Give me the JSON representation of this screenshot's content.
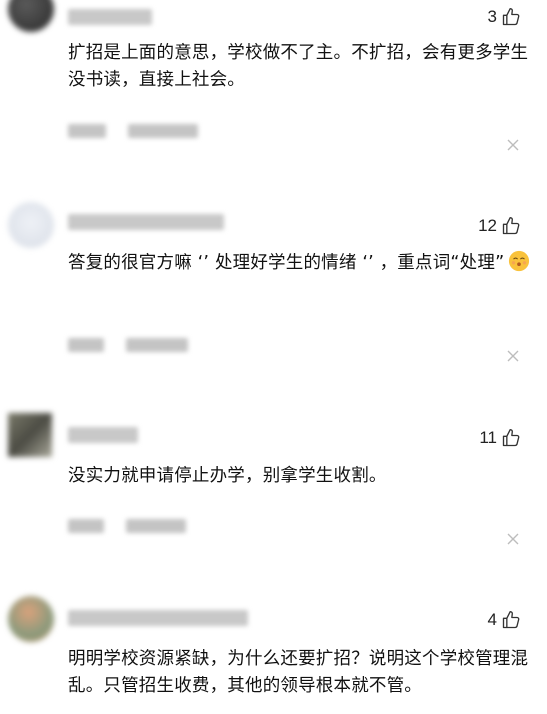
{
  "comments": [
    {
      "likes": "3",
      "text": "扩招是上面的意思，学校做不了主。不扩招，会有更多学生没书读，直接上社会。"
    },
    {
      "likes": "12",
      "text": "答复的很官方嘛 ‘’ 处理好学生的情绪 ‘’ ，重点词“处理”"
    },
    {
      "likes": "11",
      "text": "没实力就申请停止办学，别拿学生收割。"
    },
    {
      "likes": "4",
      "text": "明明学校资源紧缺，为什么还要扩招？说明这个学校管理混乱。只管招生收费，其他的领导根本就不管。"
    }
  ],
  "icons": {
    "like": "thumbs-up-icon",
    "close": "close-icon",
    "emoji": "shushing-face-emoji"
  },
  "colors": {
    "text": "#111111",
    "blur": "#c8c8c8",
    "icon": "#333333"
  }
}
